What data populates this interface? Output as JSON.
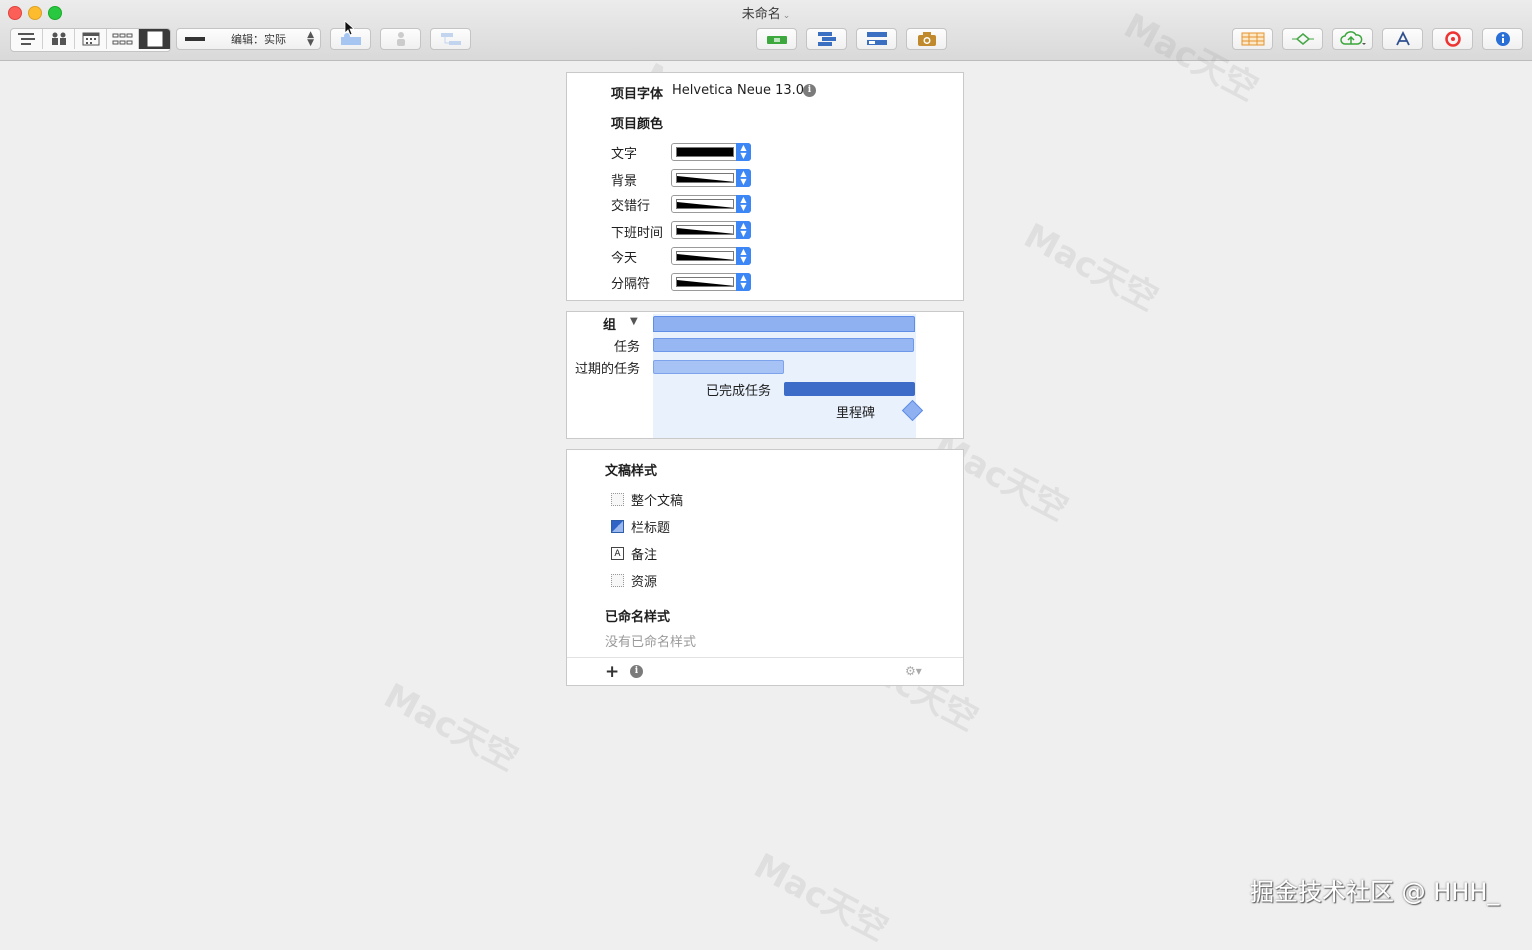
{
  "window": {
    "title": "未命名"
  },
  "toolbar": {
    "edit_mode": "编辑：实际",
    "view_buttons": [
      "outline-view",
      "resource-view",
      "calendar-view",
      "network-view",
      "style-view"
    ]
  },
  "font_section": {
    "label": "项目字体",
    "value": "Helvetica Neue 13.0",
    "color_heading": "项目颜色",
    "color_rows": [
      {
        "label": "文字",
        "solid": true
      },
      {
        "label": "背景",
        "solid": false
      },
      {
        "label": "交错行",
        "solid": false
      },
      {
        "label": "下班时间",
        "solid": false
      },
      {
        "label": "今天",
        "solid": false
      },
      {
        "label": "分隔符",
        "solid": false
      }
    ]
  },
  "gantt_preview": {
    "group": "组",
    "task": "任务",
    "overdue": "过期的任务",
    "completed": "已完成任务",
    "milestone": "里程碑"
  },
  "styles_section": {
    "heading": "文稿样式",
    "items": [
      {
        "label": "整个文稿",
        "icon": "dotted-box-icon"
      },
      {
        "label": "栏标题",
        "icon": "column-header-icon"
      },
      {
        "label": "备注",
        "icon": "note-icon"
      },
      {
        "label": "资源",
        "icon": "dotted-box-icon"
      }
    ],
    "named_heading": "已命名样式",
    "named_empty": "没有已命名样式"
  },
  "footer_watermark": "掘金技术社区 @ HHH_",
  "colors": {
    "accent": "#3d86f5",
    "bar": "#8fb1f1",
    "done": "#3c6bc8"
  }
}
